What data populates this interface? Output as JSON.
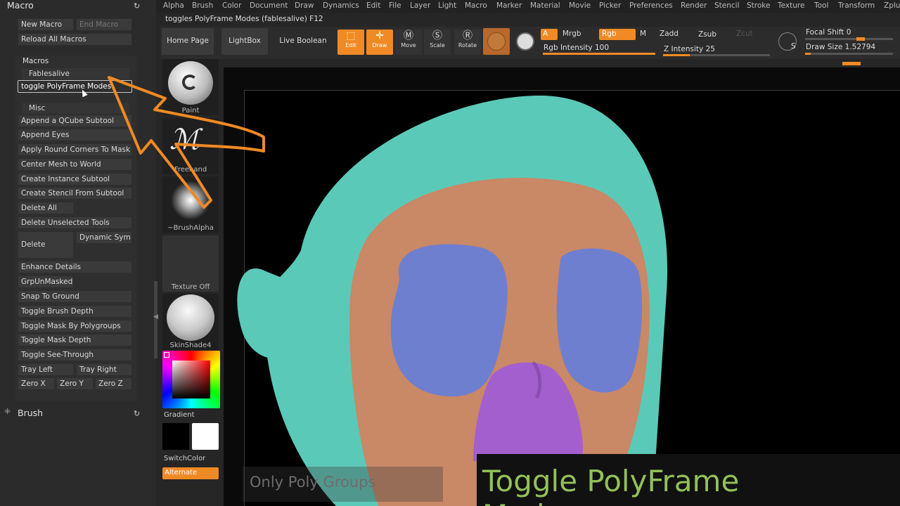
{
  "menu": [
    "Alpha",
    "Brush",
    "Color",
    "Document",
    "Draw",
    "Dynamics",
    "Edit",
    "File",
    "Layer",
    "Light",
    "Macro",
    "Marker",
    "Material",
    "Movie",
    "Picker",
    "Preferences",
    "Render",
    "Stencil",
    "Stroke",
    "Texture",
    "Tool",
    "Transform",
    "Zplu"
  ],
  "status_text": "toggles PolyFrame Modes (fablesalive) F12",
  "left_panel": {
    "title": "Macro",
    "new_macro": "New Macro",
    "end_macro": "End Macro",
    "reload_all": "Reload All Macros",
    "macros_header": "Macros",
    "fablesalive_header": "Fablesalive",
    "selected_item": "toggle PolyFrame Modes",
    "misc_header": "Misc",
    "misc_items": [
      "Append a QCube Subtool",
      "Append Eyes",
      "Apply Round Corners To Mask",
      "Center Mesh to World",
      "Create Instance Subtool",
      "Create Stencil From Subtool",
      "Delete All",
      "Delete Unselected Tools",
      "Delete",
      "Dynamic Sym",
      "Enhance Details",
      "GrpUnMasked",
      "Snap To Ground",
      "Toggle Brush Depth",
      "Toggle Mask By Polygroups",
      "Toggle Mask Depth",
      "Toggle See-Through",
      "Tray Left",
      "Tray Right",
      "Zero X",
      "Zero Y",
      "Zero Z"
    ],
    "brush_title": "Brush"
  },
  "top": {
    "home": "Home Page",
    "lightbox": "LightBox",
    "live_boolean": "Live Boolean",
    "edit": "Edit",
    "draw": "Draw",
    "move": "Move",
    "scale": "Scale",
    "rotate": "Rotate",
    "a": "A",
    "mrgb": "Mrgb",
    "rgb": "Rgb",
    "m": "M",
    "zadd": "Zadd",
    "zsub": "Zsub",
    "zcut": "Zcut",
    "rgb_intensity": "Rgb Intensity 100",
    "z_intensity": "Z Intensity 25",
    "focal_shift": "Focal Shift 0",
    "draw_size": "Draw Size 1.52794",
    "s_label": "S"
  },
  "levels": {
    "rgb_intensity": 100,
    "z_intensity": 25,
    "focal_shift": 0
  },
  "shelf": {
    "paint": "Paint",
    "freehand": "Freehand",
    "brush_alpha": "~BrushAlpha",
    "texture_off": "Texture Off",
    "skinshade": "SkinShade4",
    "gradient": "Gradient",
    "switch_color": "SwitchColor",
    "alternate": "Alternate"
  },
  "ghost_text": "Only Poly Groups",
  "caption": "Toggle PolyFrame Modes.zsc",
  "colors": {
    "accent": "#f08a24",
    "caption": "#93c05a",
    "head_teal": "#5bc9b8",
    "face": "#c98866",
    "eyes": "#6f7fcf",
    "nose": "#a45fcf"
  }
}
